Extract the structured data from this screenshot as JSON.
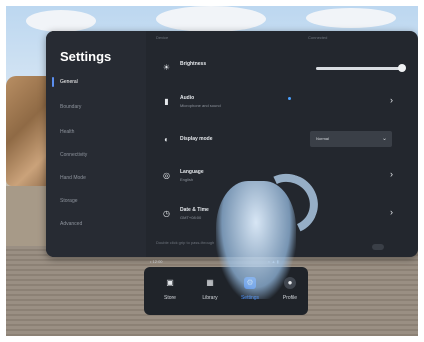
{
  "settings": {
    "title": "Settings",
    "top_left_text": "Device",
    "top_right_text": "Connected",
    "nav": [
      "General",
      "Boundary",
      "Health",
      "Connectivity",
      "Hand Mode",
      "Storage",
      "Advanced"
    ],
    "rows": [
      {
        "icon": "sun-icon",
        "label": "Brightness",
        "sub": ""
      },
      {
        "icon": "audio-icon",
        "label": "Audio",
        "sub": "Microphone and sound"
      },
      {
        "icon": "display-mode-icon",
        "label": "Display mode",
        "sub": ""
      },
      {
        "icon": "globe-icon",
        "label": "Language",
        "sub": "English"
      },
      {
        "icon": "clock-icon",
        "label": "Date & Time",
        "sub": "GMT+08:00"
      }
    ],
    "brightness_level": 0.95,
    "display_mode_value": "Normal",
    "bottom_faded_text": "Double click grip to pass-through"
  },
  "status": {
    "left": "• 12:00",
    "right": "◐ ▲ ▮"
  },
  "taskbar": {
    "items": [
      {
        "label": "Store",
        "icon": "store-icon"
      },
      {
        "label": "Library",
        "icon": "library-icon"
      },
      {
        "label": "Settings",
        "icon": "settings-icon",
        "active": true
      },
      {
        "label": "Profile",
        "icon": "profile-icon"
      }
    ]
  },
  "colors": {
    "panel": "#23272e",
    "accent": "#3f86f5"
  }
}
